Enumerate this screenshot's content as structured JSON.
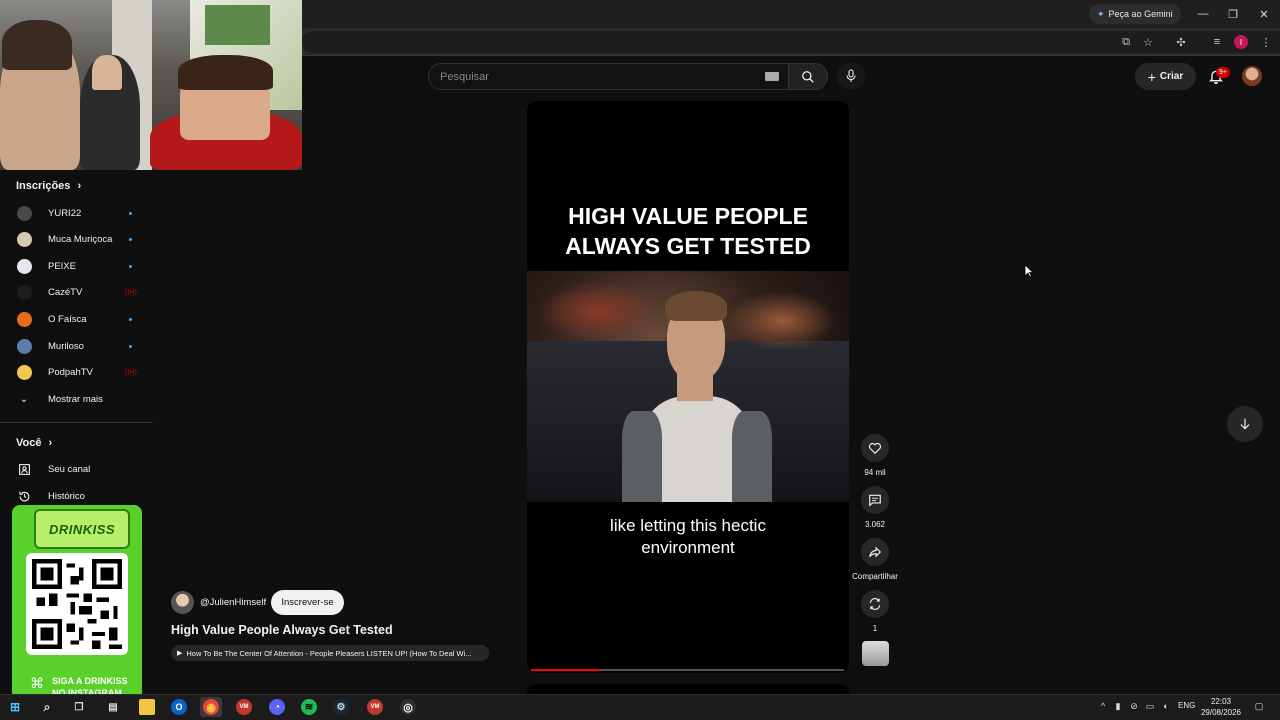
{
  "browser": {
    "gemini_label": "Peça ao Gemini",
    "profile_initial": "I"
  },
  "header": {
    "search_placeholder": "Pesquisar",
    "create_label": "Criar",
    "notifications_badge": "9+"
  },
  "sidebar": {
    "subscriptions_heading": "Inscrições",
    "subscriptions": [
      {
        "label": "YURI22",
        "color": "#4a4a4a",
        "indicator": "dot"
      },
      {
        "label": "Muca Muriçoca",
        "color": "#d8c8b0",
        "indicator": "dot"
      },
      {
        "label": "PEIXE",
        "color": "#e6e6f0",
        "indicator": "dot"
      },
      {
        "label": "CazéTV",
        "color": "#1d1d1d",
        "indicator": "live"
      },
      {
        "label": "O Faísca",
        "color": "#e86a1c",
        "indicator": "dot"
      },
      {
        "label": "Muriloso",
        "color": "#5d7aa8",
        "indicator": "dot"
      },
      {
        "label": "PodpahTV",
        "color": "#f2c94c",
        "indicator": "live"
      }
    ],
    "show_more_label": "Mostrar mais",
    "you_heading": "Você",
    "you_items": [
      {
        "label": "Seu canal",
        "icon": "user-square-icon"
      },
      {
        "label": "Histórico",
        "icon": "history-icon"
      }
    ]
  },
  "ad": {
    "brand": "DRINKISS",
    "cta_line1": "SIGA A DRINKISS",
    "cta_line2": "NO INSTAGRAM"
  },
  "short": {
    "headline_line1": "HIGH VALUE PEOPLE",
    "headline_line2": "ALWAYS GET TESTED",
    "caption_line1": "like letting this hectic",
    "caption_line2": "environment",
    "progress": 0.22
  },
  "actions": {
    "likes": "94 mil",
    "comments": "3.062",
    "share": "Compartilhar",
    "remix": "1"
  },
  "channel": {
    "handle": "@JulienHimself",
    "subscribe_label": "Inscrever-se",
    "title": "High Value People Always Get Tested",
    "related": "How To Be The Center Of Attention - People Pleasers LISTEN UP! (How To Deal Wi..."
  },
  "taskbar": {
    "lang": "ENG",
    "time": "22:03",
    "date": "29/08/2026",
    "apps": [
      "start",
      "search",
      "task-view",
      "widgets",
      "explorer",
      "outlook",
      "chrome",
      "voicemeeter",
      "discord",
      "spotify",
      "steam",
      "voicemeeter-2",
      "obs"
    ]
  },
  "colors": {
    "background": "#0f0f0f",
    "accent_red": "#ff0000",
    "subscribe_bg": "#f1f1f1",
    "ad_green": "#5ad12a"
  }
}
